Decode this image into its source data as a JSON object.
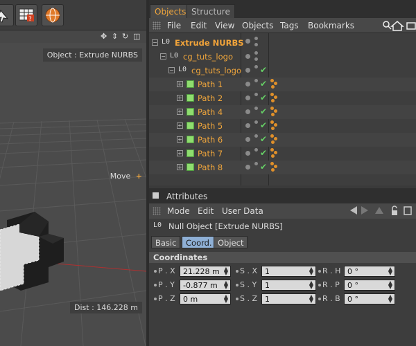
{
  "viewport": {
    "object_label": "Object : Extrude NURBS",
    "move_label": "Move",
    "dist_label": "Dist : 146.228 m"
  },
  "objects_manager": {
    "tabs": [
      {
        "label": "Objects"
      },
      {
        "label": "Structure"
      }
    ],
    "menu": [
      "File",
      "Edit",
      "View",
      "Objects",
      "Tags",
      "Bookmarks"
    ],
    "rows": [
      {
        "label": "Extrude NURBS"
      },
      {
        "label": "cg_tuts_logo"
      },
      {
        "label": "cg_tuts_logo"
      },
      {
        "label": "Path 1"
      },
      {
        "label": "Path 2"
      },
      {
        "label": "Path 4"
      },
      {
        "label": "Path 5"
      },
      {
        "label": "Path 6"
      },
      {
        "label": "Path 7"
      },
      {
        "label": "Path 8"
      }
    ]
  },
  "attributes": {
    "header": "Attributes",
    "menu": [
      "Mode",
      "Edit",
      "User Data"
    ],
    "object_title": "Null Object [Extrude NURBS]",
    "tabs": [
      "Basic",
      "Coord.",
      "Object"
    ],
    "section": "Coordinates",
    "fields": {
      "px_label": "P . X",
      "px": "21.228 m",
      "py_label": "P . Y",
      "py": "-0.877 m",
      "pz_label": "P . Z",
      "pz": "0 m",
      "sx_label": "S . X",
      "sx": "1",
      "sy_label": "S . Y",
      "sy": "1",
      "sz_label": "S . Z",
      "sz": "1",
      "rh_label": "R . H",
      "rh": "0 °",
      "rp_label": "R . P",
      "rp": "0 °",
      "rb_label": "R . B",
      "rb": "0 °"
    }
  },
  "colors": {
    "accent": "#f0a63c",
    "check": "#66d066",
    "active_subtab": "#8fb0d6"
  }
}
